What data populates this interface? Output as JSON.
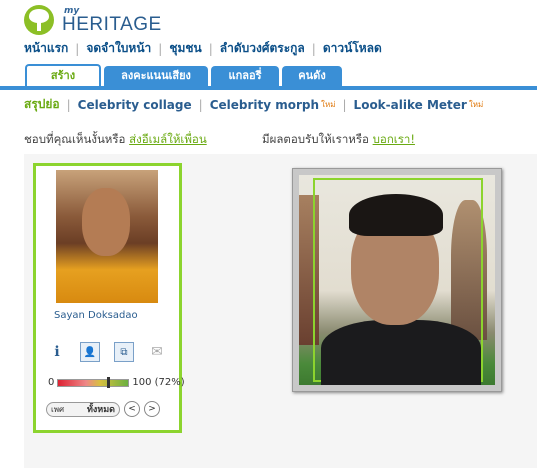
{
  "logo": {
    "my": "my",
    "heritage": "HERITAGE"
  },
  "topnav": [
    "หน้าแรก",
    "จดจำใบหน้า",
    "ชุมชน",
    "ลำดับวงศ์ตระกูล",
    "ดาวน์โหลด"
  ],
  "tabs": [
    "สร้าง",
    "ลงคะแนนเสียง",
    "แกลอรี่",
    "คนดัง"
  ],
  "subnav": {
    "items": [
      "สรุปย่อ",
      "Celebrity collage",
      "Celebrity morph",
      "Look-alike Meter"
    ],
    "new_badge": "ใหม่"
  },
  "prompt_left": {
    "text": "ชอบที่คุณเห็นงั้นหรือ",
    "link": "ส่งอีเมล์ให้เพื่อน"
  },
  "prompt_right": {
    "text": "มีผลตอบรับให้เราหรือ",
    "link": "บอกเรา!"
  },
  "match": {
    "name": "Sayan Doksadao",
    "scale_min": "0",
    "scale_max": "100",
    "percent_label": "(72%)",
    "percent": 72,
    "gender_label": "เพศ",
    "gender_value": "ทั้งหมด",
    "prev": "<",
    "next": ">"
  },
  "icons": [
    "info-icon",
    "person-card-icon",
    "compare-icon",
    "email-icon"
  ]
}
